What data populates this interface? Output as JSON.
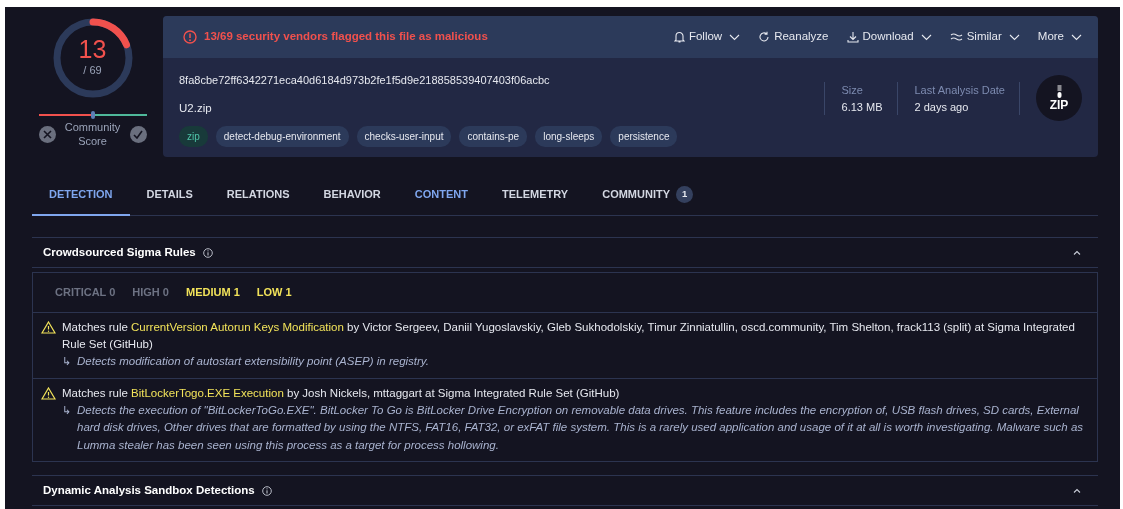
{
  "score": {
    "detections": "13",
    "total": "/ 69",
    "community_label": "Community Score"
  },
  "banner": {
    "message": "13/69 security vendors flagged this file as malicious"
  },
  "actions": [
    {
      "label": "Follow",
      "dropdown": true
    },
    {
      "label": "Reanalyze",
      "dropdown": false
    },
    {
      "label": "Download",
      "dropdown": true
    },
    {
      "label": "Similar",
      "dropdown": true
    },
    {
      "label": "More",
      "dropdown": true
    }
  ],
  "file": {
    "hash": "8fa8cbe72ff6342271eca40d6184d973b2fe1f5d9e218858539407403f06acbc",
    "name": "U2.zip",
    "type_label": "ZIP"
  },
  "tags": [
    {
      "label": "zip",
      "kind": "filetype"
    },
    {
      "label": "detect-debug-environment",
      "kind": "tag"
    },
    {
      "label": "checks-user-input",
      "kind": "tag"
    },
    {
      "label": "contains-pe",
      "kind": "tag"
    },
    {
      "label": "long-sleeps",
      "kind": "tag"
    },
    {
      "label": "persistence",
      "kind": "tag"
    }
  ],
  "stats": [
    {
      "label": "Size",
      "value": "6.13 MB"
    },
    {
      "label": "Last Analysis Date",
      "value": "2 days ago"
    }
  ],
  "tabs": [
    {
      "label": "DETECTION",
      "selected": true,
      "hovered": false
    },
    {
      "label": "DETAILS",
      "selected": false,
      "hovered": false
    },
    {
      "label": "RELATIONS",
      "selected": false,
      "hovered": false
    },
    {
      "label": "BEHAVIOR",
      "selected": false,
      "hovered": false
    },
    {
      "label": "CONTENT",
      "selected": false,
      "hovered": true
    },
    {
      "label": "TELEMETRY",
      "selected": false,
      "hovered": false
    },
    {
      "label": "COMMUNITY",
      "selected": false,
      "hovered": false,
      "count": "1"
    }
  ],
  "sigma": {
    "title": "Crowdsourced Sigma Rules",
    "expanded": true,
    "severities": [
      {
        "label": "CRITICAL 0",
        "active": false
      },
      {
        "label": "HIGH 0",
        "active": false
      },
      {
        "label": "MEDIUM 1",
        "active": true
      },
      {
        "label": "LOW 1",
        "active": true
      }
    ],
    "rules": [
      {
        "prefix": "Matches rule",
        "name": "CurrentVersion Autorun Keys Modification",
        "suffix": "by Victor Sergeev, Daniil Yugoslavskiy, Gleb Sukhodolskiy, Timur Zinniatullin, oscd.community, Tim Shelton, frack113 (split) at Sigma Integrated Rule Set (GitHub)",
        "arrow": "↳",
        "description": "Detects modification of autostart extensibility point (ASEP) in registry."
      },
      {
        "prefix": "Matches rule",
        "name": "BitLockerTogo.EXE Execution",
        "suffix": "by Josh Nickels, mttaggart at Sigma Integrated Rule Set (GitHub)",
        "arrow": "↳",
        "description": "Detects the execution of \"BitLockerToGo.EXE\". BitLocker To Go is BitLocker Drive Encryption on removable data drives. This feature includes the encryption of, USB flash drives, SD cards, External hard disk drives, Other drives that are formatted by using the NTFS, FAT16, FAT32, or exFAT file system. This is a rarely used application and usage of it at all is worth investigating. Malware such as Lumma stealer has been seen using this process as a target for process hollowing."
      }
    ]
  },
  "sandbox": {
    "title": "Dynamic Analysis Sandbox Detections",
    "expanded": true
  }
}
